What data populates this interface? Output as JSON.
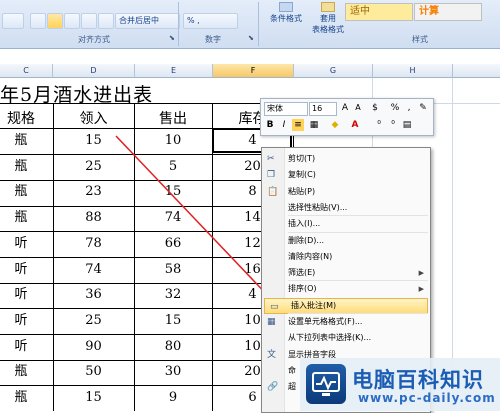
{
  "ribbon": {
    "alignment_group_label": "对齐方式",
    "number_group_label": "数字",
    "styles_group_label": "样式",
    "merge_center_label": "合并后居中",
    "number_format_label": "% ,",
    "conditional_format_label": "条件格式",
    "apply_label": "套用",
    "table_format_label": "表格格式",
    "style_medium": "适中",
    "style_calc": "计算",
    "colors": {
      "medium_bg": "#ffeb9c",
      "calc_bg": "#f2f2f2",
      "calc_text": "#fa7d00"
    }
  },
  "columns": [
    "C",
    "D",
    "E",
    "F",
    "G",
    "H"
  ],
  "selected_column": "F",
  "sheet": {
    "title": "年5月酒水进出表",
    "headers": [
      "规格",
      "领入",
      "售出",
      "库存"
    ],
    "rows": [
      [
        "瓶",
        "15",
        "10",
        "4"
      ],
      [
        "瓶",
        "25",
        "5",
        "20"
      ],
      [
        "瓶",
        "23",
        "15",
        "8"
      ],
      [
        "瓶",
        "88",
        "74",
        "14"
      ],
      [
        "听",
        "78",
        "66",
        "12"
      ],
      [
        "听",
        "74",
        "58",
        "16"
      ],
      [
        "听",
        "36",
        "32",
        "4"
      ],
      [
        "听",
        "25",
        "15",
        "10"
      ],
      [
        "听",
        "90",
        "80",
        "10"
      ],
      [
        "瓶",
        "50",
        "30",
        "20"
      ],
      [
        "瓶",
        "15",
        "9",
        "6"
      ]
    ]
  },
  "mini_toolbar": {
    "font_name": "宋体",
    "font_size": "16",
    "grow_font": "A",
    "shrink_font": "A",
    "currency": "$",
    "percent": "%",
    "comma": ",",
    "bold": "B",
    "italic": "I",
    "font_color_letter": "A"
  },
  "context_menu": {
    "items": [
      {
        "label": "剪切(T)",
        "icon": "scissors-icon"
      },
      {
        "label": "复制(C)",
        "icon": "copy-icon"
      },
      {
        "label": "粘贴(P)",
        "icon": "paste-icon"
      },
      {
        "label": "选择性粘贴(V)...",
        "icon": ""
      },
      {
        "label": "插入(I)...",
        "icon": ""
      },
      {
        "label": "删除(D)...",
        "icon": ""
      },
      {
        "label": "清除内容(N)",
        "icon": ""
      },
      {
        "label": "筛选(E)",
        "icon": "",
        "submenu": true
      },
      {
        "label": "排序(O)",
        "icon": "",
        "submenu": true
      },
      {
        "label": "插入批注(M)",
        "icon": "comment-icon",
        "highlighted": true
      },
      {
        "label": "设置单元格格式(F)...",
        "icon": "format-cells-icon"
      },
      {
        "label": "从下拉列表中选择(K)...",
        "icon": ""
      },
      {
        "label": "显示拼音字段",
        "icon": "phonetic-icon"
      },
      {
        "label": "命",
        "icon": ""
      },
      {
        "label": "超",
        "icon": "hyperlink-icon"
      }
    ]
  },
  "watermark": {
    "main": "电脑百科知识",
    "sub": "www.pc-daily.com"
  }
}
